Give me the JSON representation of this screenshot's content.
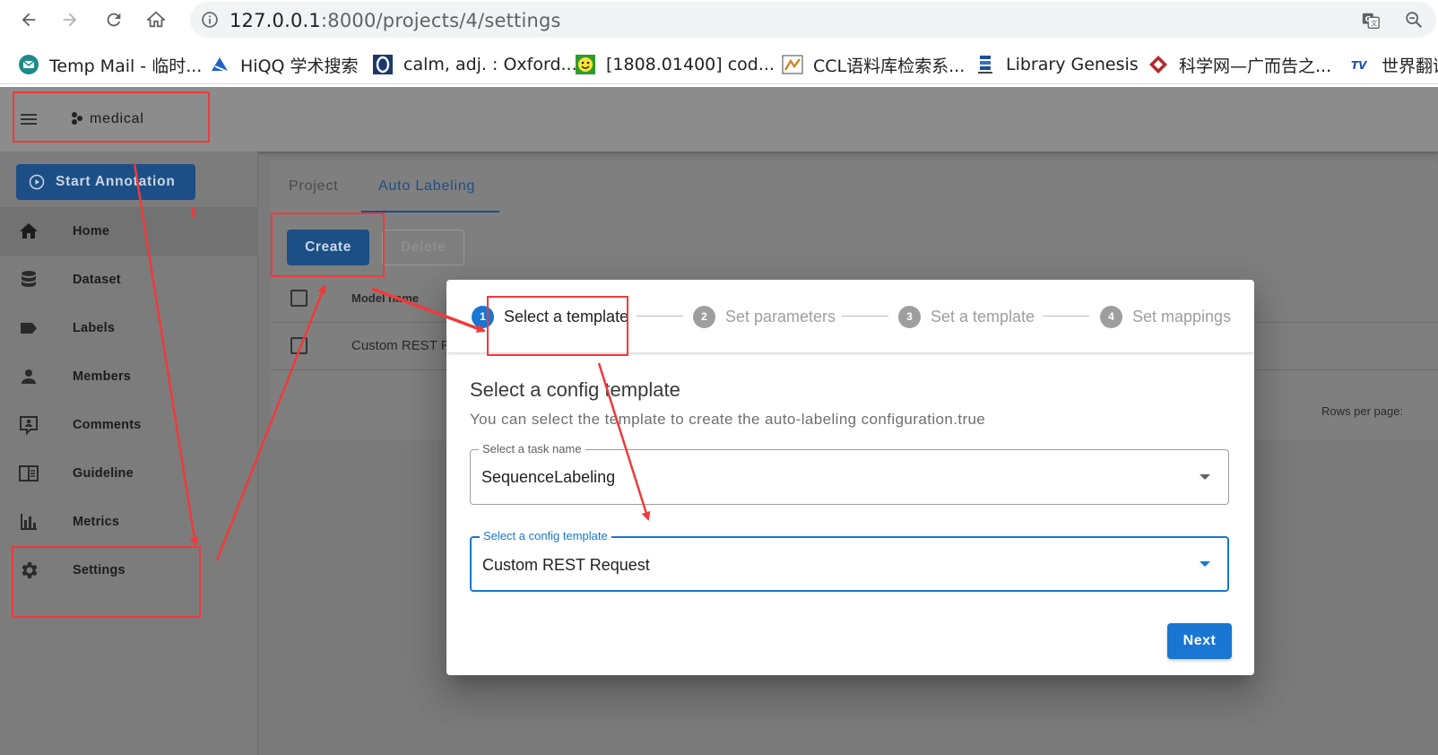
{
  "browser": {
    "url_host": "127.0.0.1",
    "url_path": ":8000/projects/4/settings",
    "bookmarks": [
      {
        "label": "Temp Mail - 临时...",
        "icon": "temp-mail-icon"
      },
      {
        "label": "HiQQ 学术搜索",
        "icon": "hiqq-icon"
      },
      {
        "label": "calm, adj. : Oxford...",
        "icon": "oxford-icon"
      },
      {
        "label": "[1808.01400] cod...",
        "icon": "arxiv-icon"
      },
      {
        "label": "CCL语料库检索系...",
        "icon": "ccl-icon"
      },
      {
        "label": "Library Genesis",
        "icon": "libgen-icon"
      },
      {
        "label": "科学网—广而告之...",
        "icon": "sciencenet-icon"
      },
      {
        "label": "世界翻译",
        "icon": "translate-site-icon"
      }
    ]
  },
  "appbar": {
    "project_name": "medical"
  },
  "sidebar": {
    "start_button": "Start Annotation",
    "items": [
      {
        "label": "Home",
        "icon": "home-icon"
      },
      {
        "label": "Dataset",
        "icon": "database-icon"
      },
      {
        "label": "Labels",
        "icon": "label-icon"
      },
      {
        "label": "Members",
        "icon": "account-icon"
      },
      {
        "label": "Comments",
        "icon": "comment-account-icon"
      },
      {
        "label": "Guideline",
        "icon": "book-open-icon"
      },
      {
        "label": "Metrics",
        "icon": "chart-bar-icon"
      },
      {
        "label": "Settings",
        "icon": "cog-icon"
      }
    ]
  },
  "content": {
    "tabs": [
      "Project",
      "Auto Labeling"
    ],
    "create_button": "Create",
    "delete_button": "Delete",
    "table_header": "Model name",
    "table_row": "Custom REST R",
    "rows_per_page": "Rows per page:"
  },
  "dialog": {
    "steps": [
      {
        "num": "1",
        "label": "Select a template"
      },
      {
        "num": "2",
        "label": "Set parameters"
      },
      {
        "num": "3",
        "label": "Set a template"
      },
      {
        "num": "4",
        "label": "Set mappings"
      }
    ],
    "title": "Select a config template",
    "subtitle": "You can select the template to create the auto-labeling configuration.true",
    "task_field": {
      "label": "Select a task name",
      "value": "SequenceLabeling"
    },
    "template_field": {
      "label": "Select a config template",
      "value": "Custom REST Request"
    },
    "next_button": "Next"
  },
  "colors": {
    "primary": "#1976d2",
    "annotation_red": "#f03a3a"
  }
}
